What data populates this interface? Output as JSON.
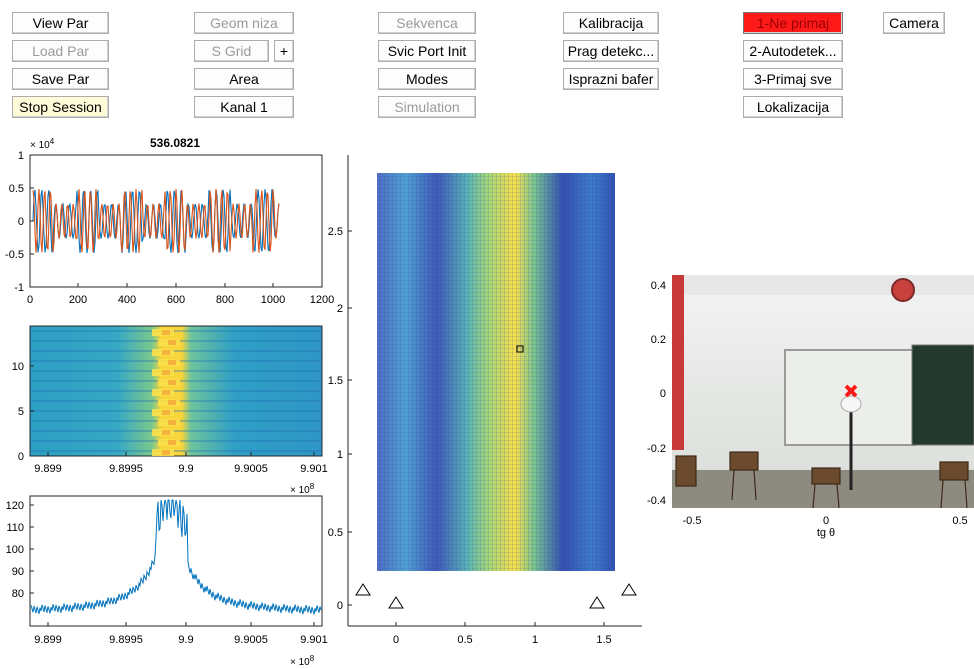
{
  "buttons": {
    "view_par": "View Par",
    "load_par": "Load Par",
    "save_par": "Save Par",
    "stop_session": "Stop Session",
    "geom_niza": "Geom niza",
    "s_grid": "S Grid",
    "plus": "+",
    "area": "Area",
    "kanal": "Kanal 1",
    "sekvenca": "Sekvenca",
    "svic_port_init": "Svic Port Init",
    "modes": "Modes",
    "simulation": "Simulation",
    "kalibracija": "Kalibracija",
    "prag_detekc": "Prag detekc...",
    "isprazni_bafer": "Isprazni bafer",
    "ne_primaj": "1-Ne primaj",
    "autodetek": "2-Autodetek...",
    "primaj_sve": "3-Primaj sve",
    "lokalizacija": "Lokalizacija",
    "camera": "Camera"
  },
  "colors": {
    "series_blue": "#0072bd",
    "series_orange": "#d95319",
    "active_red": "#ff1a1a",
    "stop_yellow": "#fffbd9"
  },
  "plots": {
    "time": {
      "title": "536.0821",
      "exponent_base": "× 10",
      "exponent_power": "4",
      "xticks": [
        "0",
        "200",
        "400",
        "600",
        "800",
        "1000",
        "1200"
      ],
      "yticks": [
        "1",
        "0.5",
        "0",
        "-0.5",
        "-1"
      ]
    },
    "spectrogram": {
      "xticks": [
        "9.899",
        "9.8995",
        "9.9",
        "9.9005",
        "9.901"
      ],
      "yticks": [
        "10",
        "5",
        "0"
      ],
      "exponent_base": "× 10",
      "exponent_power": "8"
    },
    "spectrum": {
      "xticks": [
        "9.899",
        "9.8995",
        "9.9",
        "9.9005",
        "9.901"
      ],
      "yticks": [
        "120",
        "110",
        "100",
        "90",
        "80"
      ],
      "exponent_base": "× 10",
      "exponent_power": "8"
    },
    "map": {
      "xticks": [
        "0",
        "0.5",
        "1",
        "1.5"
      ],
      "yticks": [
        "2.5",
        "2",
        "1.5",
        "1",
        "0.5",
        "0"
      ]
    },
    "camera": {
      "xticks": [
        "-0.5",
        "0",
        "0.5"
      ],
      "yticks": [
        "0.4",
        "0.2",
        "0",
        "-0.2",
        "-0.4"
      ],
      "xlabel": "tg θ"
    }
  }
}
